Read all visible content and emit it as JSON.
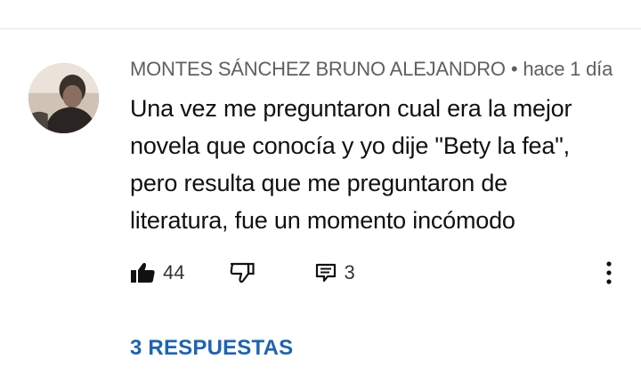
{
  "comment": {
    "author": "MONTES SÁNCHEZ BRUNO ALEJANDRO",
    "separator": "•",
    "time": "hace 1 día",
    "text_lines": [
      "Una vez me preguntaron cual era la mejor",
      "novela que conocía y yo dije \"Bety la fea\",",
      "pero resulta que me preguntaron de",
      "literatura, fue un momento incómodo"
    ],
    "likes": "44",
    "reply_count": "3",
    "replies_label": "3 RESPUESTAS"
  },
  "icons": {
    "like": "thumbs-up-filled-icon",
    "dislike": "thumbs-down-outline-icon",
    "reply": "comment-reply-icon",
    "more": "more-vertical-icon"
  },
  "colors": {
    "link": "#1e63b5",
    "meta": "#5f5f5f",
    "text": "#111111"
  }
}
